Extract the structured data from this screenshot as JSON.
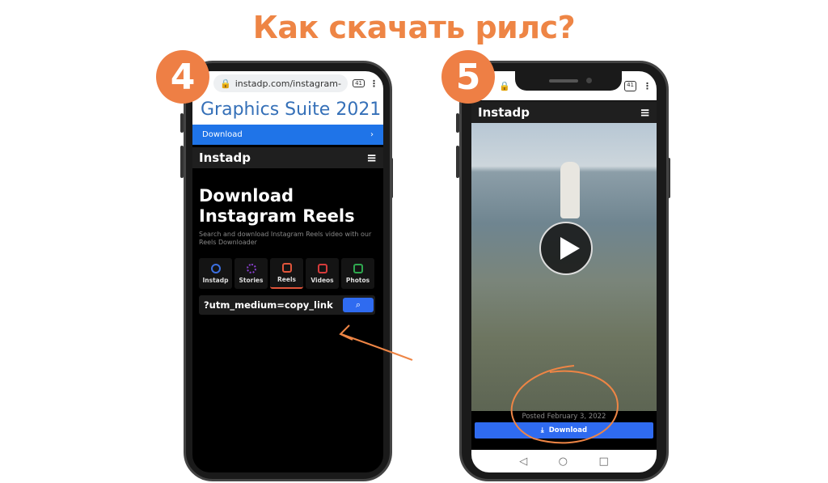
{
  "title": "Как скачать рилс?",
  "step4": {
    "badge": "4",
    "address": "instadp.com/instagram-",
    "tab_count": "41",
    "ad_text": "Graphics Suite 2021",
    "ad_button": "Download",
    "brand": "Instadp",
    "heading_line1": "Download",
    "heading_line2": "Instagram Reels",
    "subtitle": "Search and download Instagram Reels video with our Reels Downloader",
    "tabs": [
      {
        "label": "Instadp",
        "color": "#3b6fe0"
      },
      {
        "label": "Stories",
        "color": "#8a3fd1"
      },
      {
        "label": "Reels",
        "color": "#e0553b"
      },
      {
        "label": "Videos",
        "color": "#d63b3b"
      },
      {
        "label": "Photos",
        "color": "#2fa84f"
      }
    ],
    "active_tab": "Reels",
    "search_value": "?utm_medium=copy_link"
  },
  "step5": {
    "badge": "5",
    "tab_count": "41",
    "brand": "Instadp",
    "posted": "Posted February 3, 2022",
    "download_button": "Download"
  },
  "colors": {
    "accent": "#EE8545",
    "button": "#2f6bf0"
  }
}
